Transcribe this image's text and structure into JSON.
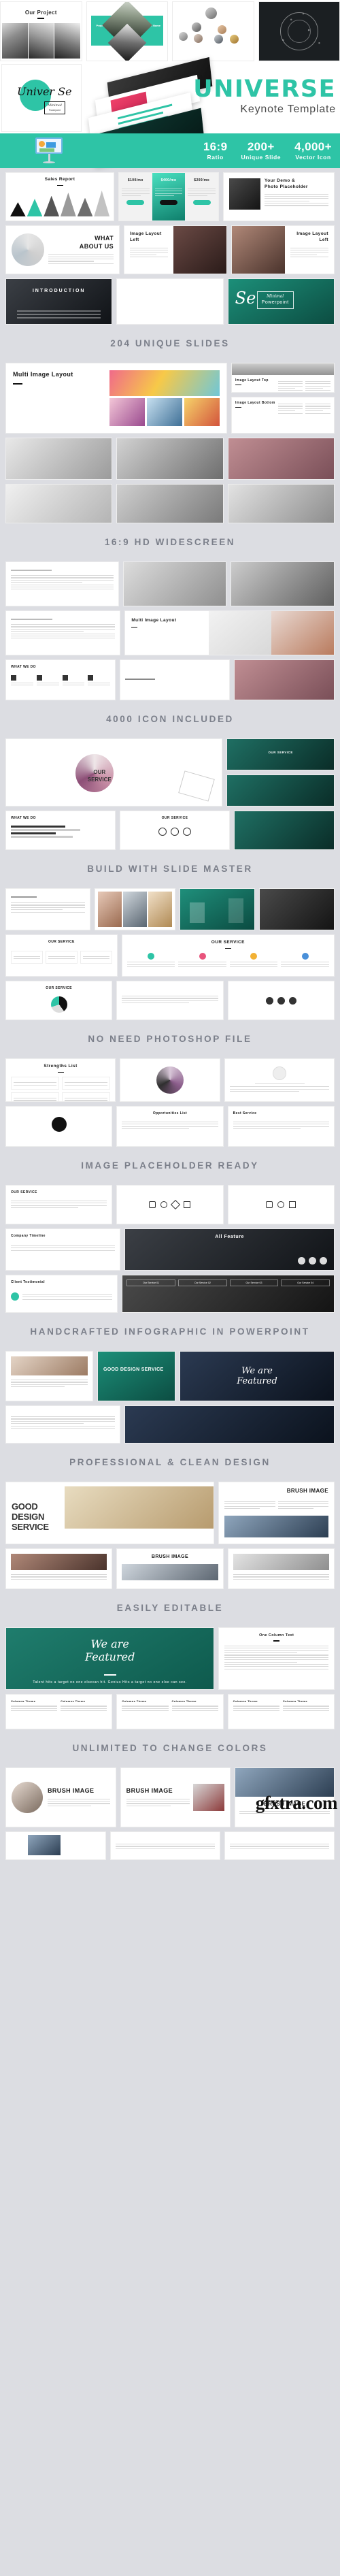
{
  "brand": {
    "title": "UNIVERSE",
    "subtitle": "Keynote Template",
    "logo_script": "Univer Se",
    "logo_badge_top": "Minimal",
    "logo_badge_bottom": "Powerpoint"
  },
  "stats": [
    {
      "number": "16:9",
      "label": "Ratio"
    },
    {
      "number": "200+",
      "label": "Unique Slide"
    },
    {
      "number": "4,000+",
      "label": "Vector Icon"
    }
  ],
  "dividers": [
    "204 UNIQUE SLIDES",
    "16:9 HD WIDESCREEN",
    "4000 ICON INCLUDED",
    "BUILD WITH SLIDE MASTER",
    "NO NEED PHOTOSHOP FILE",
    "IMAGE PLACEHOLDER READY",
    "HANDCRAFTED INFOGRAPHIC IN POWERPOINT",
    "PROFESSIONAL & CLEAN DESIGN",
    "EASILY EDITABLE",
    "UNLIMITED TO CHANGE COLORS"
  ],
  "slides": {
    "our_project": "Our Project",
    "project_name_left": "Project Name",
    "project_name_right": "Project Name",
    "sales_report": "Sales Report",
    "your_demo": "Your Demo &",
    "photo_placeholder": "Photo Placeholder",
    "what_line1": "WHAT",
    "what_line2": "ABOUT US",
    "image_layout_left": "Image Layout Left",
    "image_layout_left2": "Image Layout Left",
    "introduction": "INTRODUCTION",
    "cover_se": "Se",
    "cover_badge_top": "Minimal",
    "cover_badge_bottom": "Powerpoint",
    "cover_script": "Univer",
    "multi_image_layout": "Multi Image Layout",
    "image_layout_top": "Image Layout Top",
    "image_layout_bottom": "Image Layout Bottom",
    "our_service": "OUR SERVICE",
    "our_service_dark": "OUR SERVICE",
    "what_we_do": "WHAT WE DO",
    "strengths_list": "Strengths List",
    "all_feature": "All Feature",
    "good_design_service": "GOOD DESIGN SERVICE",
    "we_are_featured_line1": "We are",
    "we_are_featured_line2": "Featured",
    "we_are_featured_quote": "Talent hits a target no one elsecan hit. Genius Hits a target no one else can see.",
    "brush_image": "BRUSH IMAGE",
    "one_column_text": "One Column Text",
    "our_service_01": "Our Service 01",
    "our_service_02": "Our Service 02",
    "our_service_03": "Our Service 03",
    "our_service_04": "Our Service 04",
    "company_timeline": "Company Timeline",
    "client_testimonial": "Client Testimonial",
    "opportunities_list": "Opportunities List",
    "best_service": "Best Service"
  },
  "colors": {
    "accent": "#2ec4a6",
    "page_bg": "#dcdde2",
    "divider_text": "#7b7f8a"
  },
  "watermark": "gfxtra.com"
}
